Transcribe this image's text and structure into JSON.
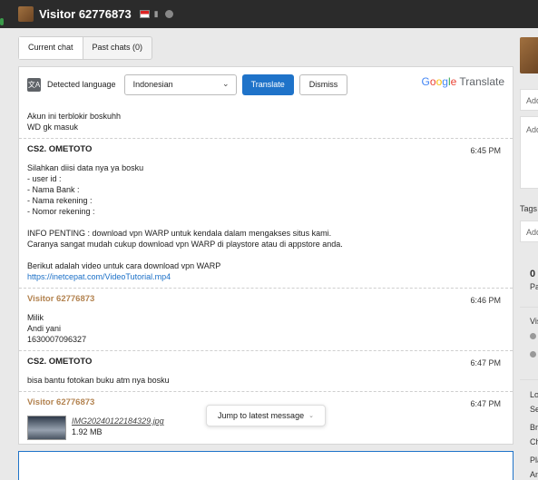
{
  "header": {
    "title": "Visitor 62776873"
  },
  "tabs": [
    {
      "label": "Current chat"
    },
    {
      "label": "Past chats (0)"
    }
  ],
  "translate": {
    "label": "Detected language",
    "selected_language": "Indonesian",
    "translate_button": "Translate",
    "dismiss_button": "Dismiss",
    "brand_google": "Google",
    "brand_translate": "Translate"
  },
  "first_message": {
    "lines": [
      "Akun ini terblokir boskuhh",
      "WD gk masuk"
    ]
  },
  "messages": [
    {
      "sender": "CS2. OMETOTO",
      "time": "6:45 PM",
      "lines": [
        "Silahkan diisi data nya ya bosku",
        "- user id :",
        "- Nama Bank :",
        "- Nama rekening :",
        "- Nomor rekening :",
        "",
        "INFO PENTING : download vpn WARP untuk kendala dalam mengakses situs kami.",
        "Caranya sangat mudah cukup download vpn WARP di playstore atau di appstore anda.",
        "",
        "Berikut adalah video untuk cara download vpn WARP"
      ],
      "link": "https://inetcepat.com/VideoTutorial.mp4"
    },
    {
      "sender": "Visitor 62776873",
      "time": "6:46 PM",
      "lines": [
        "Milik",
        "Andi yani",
        "1630007096327"
      ]
    },
    {
      "sender": "CS2. OMETOTO",
      "time": "6:47 PM",
      "lines": [
        "bisa bantu fotokan buku atm nya bosku"
      ]
    },
    {
      "sender": "Visitor 62776873",
      "time": "6:47 PM",
      "attachment": {
        "name": "IMG20240122184329.jpg",
        "size": "1.92 MB"
      }
    }
  ],
  "jump_button": "Jump to latest message",
  "sidebar": {
    "field1": "Add",
    "field2": "Add",
    "tags_label": "Tags",
    "tags_field": "Add",
    "count": "0",
    "count_label": "Pa",
    "visitor_label": "Vis",
    "info": [
      "Lo",
      "Se",
      "Br",
      "Ch",
      "Pla",
      "An"
    ]
  },
  "colors": {
    "accent": "#1f73c9",
    "visitor_name": "#b38350",
    "header_bg": "#2b2b2b"
  }
}
